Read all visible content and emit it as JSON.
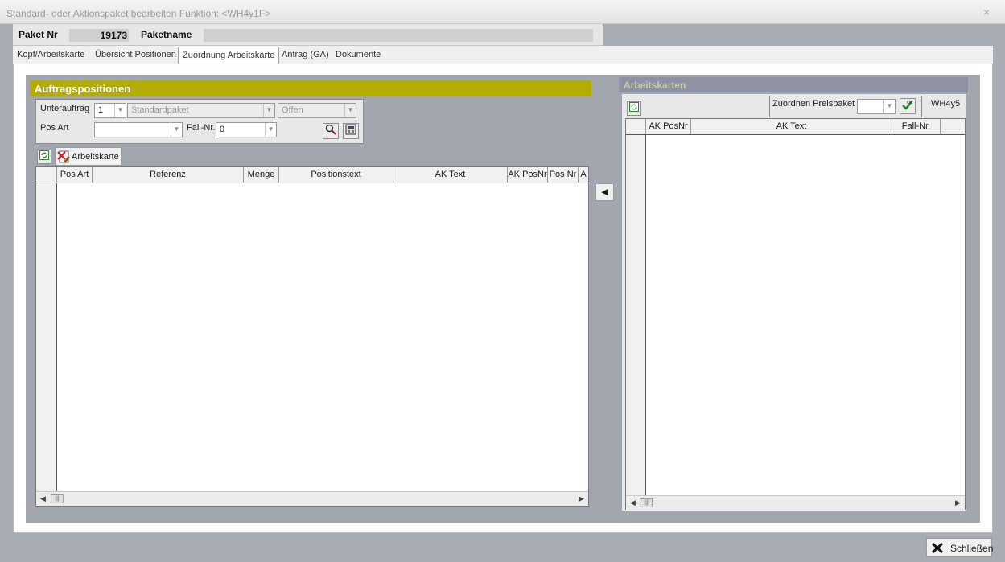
{
  "window": {
    "title": "Standard- oder Aktionspaket bearbeiten   Funktion: <WH4y1F>",
    "close_glyph": "×"
  },
  "header": {
    "paket_nr_label": "Paket Nr",
    "paket_nr_value": "19173",
    "paketname_label": "Paketname",
    "paketname_value": ""
  },
  "tabs": [
    {
      "label": "Kopf/Arbeitskarte"
    },
    {
      "label": "Übersicht Positionen"
    },
    {
      "label": "Zuordnung Arbeitskarte"
    },
    {
      "label": "Antrag (GA)"
    },
    {
      "label": "Dokumente"
    }
  ],
  "active_tab": "Zuordnung Arbeitskarte",
  "left": {
    "title": "Auftragspositionen",
    "filters": {
      "unterauftrag_label": "Unterauftrag",
      "unterauftrag_value": "1",
      "paket_type_value": "Standardpaket",
      "status_value": "Offen",
      "pos_art_label": "Pos Art",
      "pos_art_value": "",
      "fall_nr_label": "Fall-Nr.",
      "fall_nr_value": "0"
    },
    "toolbar": {
      "arbeitskarte_label": "Arbeitskarte"
    },
    "columns": [
      "Pos Art",
      "Referenz",
      "Menge",
      "Positionstext",
      "AK Text",
      "AK PosNr",
      "Pos Nr",
      "A"
    ]
  },
  "right": {
    "title": "Arbeitskarten",
    "zuordnen_label": "Zuordnen Preispaket",
    "zuordnen_value": "",
    "code_label": "WH4y5",
    "columns": [
      "AK PosNr",
      "AK Text",
      "Fall-Nr."
    ]
  },
  "footer": {
    "close_label": "Schließen"
  },
  "colors": {
    "section_title": "#b4ac00",
    "right_title": "#8e92a2",
    "panel_bg": "#a2a6ae"
  },
  "icons": [
    "refresh-icon",
    "search-icon",
    "calculator-icon",
    "arbeitskarte-icon",
    "check-icon",
    "arrow-left-icon",
    "close-x-icon"
  ]
}
